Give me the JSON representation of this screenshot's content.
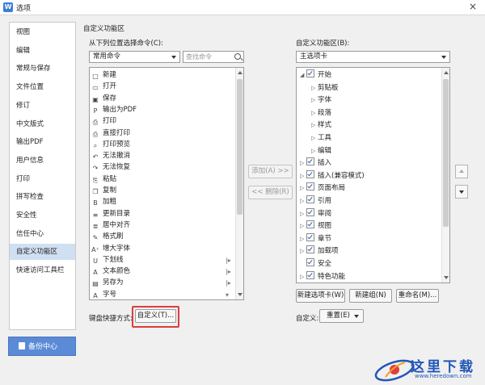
{
  "window": {
    "title": "选项",
    "app_icon": "W",
    "close_icon": "×"
  },
  "sidebar": {
    "items": [
      {
        "label": "视图"
      },
      {
        "label": "编辑"
      },
      {
        "label": "常规与保存"
      },
      {
        "label": "文件位置"
      },
      {
        "label": "修订"
      },
      {
        "label": "中文版式"
      },
      {
        "label": "输出PDF"
      },
      {
        "label": "用户信息"
      },
      {
        "label": "打印"
      },
      {
        "label": "拼写检查"
      },
      {
        "label": "安全性"
      },
      {
        "label": "信任中心"
      },
      {
        "label": "自定义功能区",
        "active": true
      },
      {
        "label": "快速访问工具栏"
      }
    ],
    "backup_label": "备份中心"
  },
  "main": {
    "section_title": "自定义功能区",
    "left": {
      "label": "从下列位置选择命令(C):",
      "source_combo": "常用命令",
      "search_placeholder": "查找命令",
      "commands": [
        {
          "icon": "□",
          "label": "新建"
        },
        {
          "icon": "▭",
          "label": "打开"
        },
        {
          "icon": "▣",
          "label": "保存"
        },
        {
          "icon": "P",
          "label": "输出为PDF"
        },
        {
          "icon": "⎙",
          "label": "打印"
        },
        {
          "icon": "⎙",
          "label": "直接打印"
        },
        {
          "icon": "⌕",
          "label": "打印预览"
        },
        {
          "icon": "↶",
          "label": "无法撤消"
        },
        {
          "icon": "↷",
          "label": "无法恢复"
        },
        {
          "icon": "⎘",
          "label": "粘贴"
        },
        {
          "icon": "❐",
          "label": "复制"
        },
        {
          "icon": "B",
          "label": "加粗"
        },
        {
          "icon": "≡",
          "label": "更新目录"
        },
        {
          "icon": "≣",
          "label": "居中对齐"
        },
        {
          "icon": "✎",
          "label": "格式刷"
        },
        {
          "icon": "A⁺",
          "label": "增大字体"
        },
        {
          "icon": "U",
          "label": "下划线",
          "sub": "|▸"
        },
        {
          "icon": "A",
          "label": "文本颜色",
          "sub": "|▸"
        },
        {
          "icon": "▤",
          "label": "另存为",
          "sub": "|▸"
        },
        {
          "icon": "A",
          "label": "字号",
          "sub": "▾"
        }
      ],
      "shortcut_label": "键盘快捷方式:",
      "customize_button": "自定义(T)..."
    },
    "middle": {
      "add_button": "添加(A) >>",
      "remove_button": "<< 删除(R)"
    },
    "right": {
      "label": "自定义功能区(B):",
      "tabs_combo": "主选项卡",
      "tree": [
        {
          "level": 0,
          "expanded": true,
          "checked": true,
          "label": "开始"
        },
        {
          "level": 1,
          "label": "剪贴板"
        },
        {
          "level": 1,
          "label": "字体"
        },
        {
          "level": 1,
          "label": "段落"
        },
        {
          "level": 1,
          "label": "样式"
        },
        {
          "level": 1,
          "label": "工具"
        },
        {
          "level": 1,
          "label": "编辑"
        },
        {
          "level": 0,
          "checked": true,
          "label": "插入"
        },
        {
          "level": 0,
          "checked": true,
          "label": "插入(兼容模式)"
        },
        {
          "level": 0,
          "checked": true,
          "label": "页面布局"
        },
        {
          "level": 0,
          "checked": true,
          "label": "引用"
        },
        {
          "level": 0,
          "checked": true,
          "label": "审阅"
        },
        {
          "level": 0,
          "checked": true,
          "label": "视图"
        },
        {
          "level": 0,
          "checked": true,
          "label": "章节"
        },
        {
          "level": 0,
          "checked": true,
          "label": "加载项"
        },
        {
          "level": 0,
          "checked": true,
          "label": "安全",
          "noarrow": true
        },
        {
          "level": 0,
          "checked": true,
          "label": "特色功能"
        }
      ],
      "new_tab_button": "新建选项卡(W)",
      "new_group_button": "新建组(N)",
      "rename_button": "重命名(M)...",
      "customize_label": "自定义:",
      "reset_button": "重置(E)"
    }
  },
  "watermark": {
    "text": "这里下载",
    "url": "www.heredown.com"
  },
  "colors": {
    "accent": "#5b8bd6",
    "selected": "#d0dff2",
    "highlight": "#e03c3c"
  }
}
